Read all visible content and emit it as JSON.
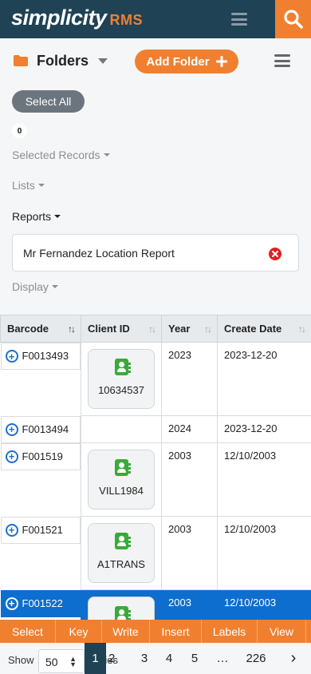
{
  "header": {
    "brand": "simplicity",
    "brand_suffix": "RMS",
    "menu_icon": "hamburger-icon",
    "search_icon": "search-icon"
  },
  "folders_bar": {
    "title": "Folders",
    "add_button": "Add Folder"
  },
  "controls": {
    "select_all": "Select All",
    "selected_count": "0",
    "selected_records": "Selected Records",
    "lists": "Lists",
    "reports": "Reports",
    "report_value": "Mr Fernandez Location Report",
    "display": "Display"
  },
  "table": {
    "columns": [
      "Barcode",
      "Client ID",
      "Year",
      "Create Date"
    ],
    "rows": [
      {
        "barcode": "F0013493",
        "client_id": "10634537",
        "year": "2023",
        "create_date": "2023-12-20"
      },
      {
        "barcode": "F0013494",
        "client_id": "",
        "year": "2024",
        "create_date": "2023-12-20"
      },
      {
        "barcode": "F001519",
        "client_id": "VILL1984",
        "year": "2003",
        "create_date": "12/10/2003"
      },
      {
        "barcode": "F001521",
        "client_id": "A1TRANS",
        "year": "2003",
        "create_date": "12/10/2003"
      },
      {
        "barcode": "F001522",
        "client_id": "",
        "year": "2003",
        "create_date": "12/10/2003"
      }
    ]
  },
  "actions": [
    "Select",
    "Key",
    "Write",
    "Insert",
    "Labels",
    "View"
  ],
  "pager": {
    "show_label": "Show",
    "page_size": "50",
    "entries_ghost": "ries",
    "pages": [
      "1",
      "2",
      "3",
      "4",
      "5",
      "…",
      "226"
    ],
    "next": "›"
  },
  "colors": {
    "topbar": "#1f4255",
    "accent": "#f08030",
    "selected_row": "#0d6ecf",
    "contact_icon": "#3aaa3a"
  }
}
